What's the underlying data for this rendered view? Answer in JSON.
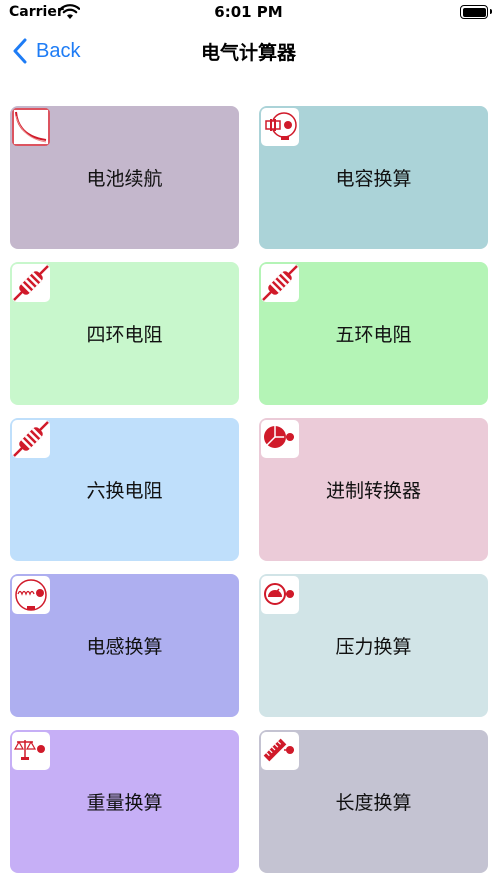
{
  "status": {
    "carrier": "Carrier",
    "time": "6:01 PM"
  },
  "nav": {
    "back_label": "Back",
    "title": "电气计算器",
    "accent": "#1e7cf5"
  },
  "tiles": [
    {
      "label": "电池续航",
      "color": "#c4b7cc",
      "icon": "battery-discharge-curve-icon"
    },
    {
      "label": "电容换算",
      "color": "#abd3d8",
      "icon": "capacitor-icon"
    },
    {
      "label": "四环电阻",
      "color": "#c8f7cc",
      "icon": "resistor-icon"
    },
    {
      "label": "五环电阻",
      "color": "#b4f4b6",
      "icon": "resistor-icon"
    },
    {
      "label": "六换电阻",
      "color": "#bfdffb",
      "icon": "resistor-icon"
    },
    {
      "label": "进制转换器",
      "color": "#ebcbd8",
      "icon": "number-base-icon"
    },
    {
      "label": "电感换算",
      "color": "#aeaff0",
      "icon": "inductor-icon"
    },
    {
      "label": "压力换算",
      "color": "#d1e4e7",
      "icon": "pressure-gauge-icon"
    },
    {
      "label": "重量换算",
      "color": "#c6aff6",
      "icon": "weight-scale-icon"
    },
    {
      "label": "长度换算",
      "color": "#c4c3d2",
      "icon": "ruler-icon"
    }
  ]
}
